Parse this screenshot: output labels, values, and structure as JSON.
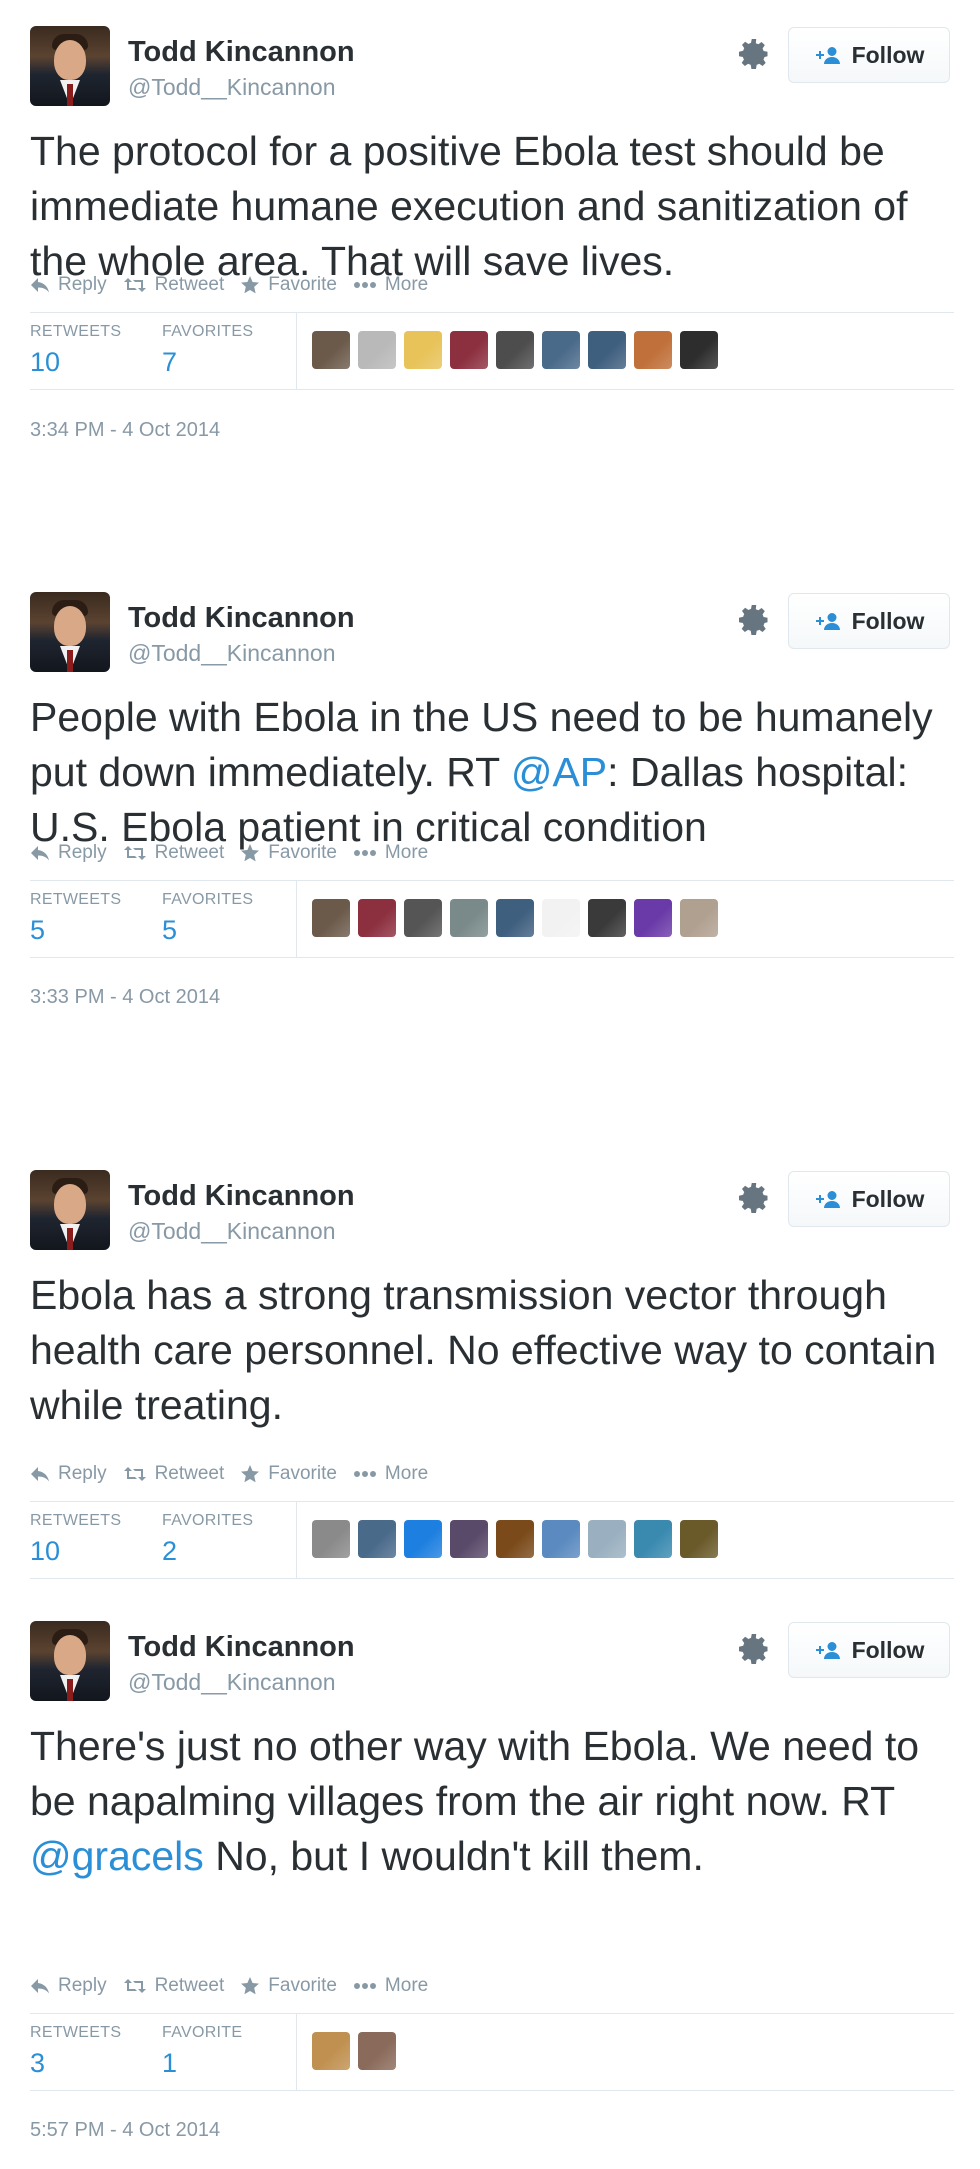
{
  "action_labels": {
    "reply": "Reply",
    "retweet": "Retweet",
    "favorite": "Favorite",
    "more": "More"
  },
  "follow_label": "Follow",
  "tweets": [
    {
      "name": "Todd Kincannon",
      "handle": "@Todd__Kincannon",
      "text": "The protocol for a positive Ebola test should be immediate humane execution and sanitization of the whole area. That will save lives.",
      "retweets_label": "RETWEETS",
      "retweets": "10",
      "favorites_label": "FAVORITES",
      "favorites": "7",
      "favoriter_avatar_colors": [
        "#6b5a4a",
        "#b9b9b9",
        "#e8c35a",
        "#8c2f3f",
        "#4d4d4d",
        "#4a6a8a",
        "#3f5f7f",
        "#c0703a",
        "#2d2d2d"
      ],
      "timestamp": "3:34 PM - 4 Oct 2014"
    },
    {
      "name": "Todd Kincannon",
      "handle": "@Todd__Kincannon",
      "text_before": "People with Ebola in the US need to be humanely put down immediately. RT ",
      "mention": "@AP",
      "text_after": ": Dallas hospital: U.S. Ebola patient in critical condition",
      "retweets_label": "RETWEETS",
      "retweets": "5",
      "favorites_label": "FAVORITES",
      "favorites": "5",
      "favoriter_avatar_colors": [
        "#6b5a4a",
        "#8c2f3f",
        "#555555",
        "#7a8a8a",
        "#3f5f7f",
        "#f2f2f2",
        "#3a3a3a",
        "#6a3aa8",
        "#b0a090"
      ],
      "timestamp": "3:33 PM - 4 Oct 2014"
    },
    {
      "name": "Todd Kincannon",
      "handle": "@Todd__Kincannon",
      "text": "Ebola has a strong transmission vector through health care personnel. No effective way to contain while treating.",
      "retweets_label": "RETWEETS",
      "retweets": "10",
      "favorites_label": "FAVORITES",
      "favorites": "2",
      "favoriter_avatar_colors": [
        "#8a8a8a",
        "#4a6a8a",
        "#1d7fe0",
        "#5a4a6a",
        "#7a4a1a",
        "#5a8ac0",
        "#9ab0c0",
        "#3a8ab0",
        "#6a5a2a"
      ],
      "timestamp": ""
    },
    {
      "name": "Todd Kincannon",
      "handle": "@Todd__Kincannon",
      "text_before": "There's just no other way with Ebola. We need to be napalming villages from the air right now. RT ",
      "mention": "@gracels",
      "text_after": " No, but I wouldn't kill them.",
      "retweets_label": "RETWEETS",
      "retweets": "3",
      "favorites_label": "FAVORITE",
      "favorites": "1",
      "favoriter_avatar_colors": [
        "#c09050",
        "#8a6a5a"
      ],
      "timestamp": "5:57 PM - 4 Oct 2014"
    }
  ]
}
